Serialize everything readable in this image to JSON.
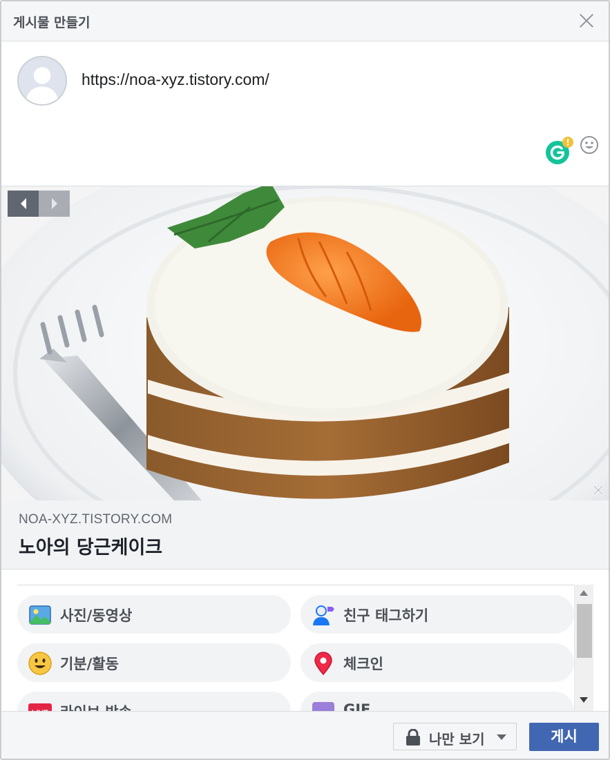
{
  "dialog": {
    "title": "게시물 만들기"
  },
  "composer": {
    "text": "https://noa-xyz.tistory.com/"
  },
  "link_preview": {
    "domain": "NOA-XYZ.TISTORY.COM",
    "title": "노아의 당근케이크",
    "image": "carrot-cake-photo"
  },
  "options": [
    {
      "label": "사진/동영상",
      "icon": "photo-video-icon"
    },
    {
      "label": "친구 태그하기",
      "icon": "tag-friends-icon"
    },
    {
      "label": "기분/활동",
      "icon": "feeling-icon"
    },
    {
      "label": "체크인",
      "icon": "check-in-icon"
    },
    {
      "label": "라이브 방송",
      "icon": "live-icon"
    },
    {
      "label": "GIF",
      "icon": "gif-icon"
    }
  ],
  "footer": {
    "privacy_label": "나만 보기",
    "post_label": "게시"
  },
  "colors": {
    "primary": "#4267b2",
    "header_bg": "#f5f6f7",
    "option_bg": "#f2f3f5"
  }
}
